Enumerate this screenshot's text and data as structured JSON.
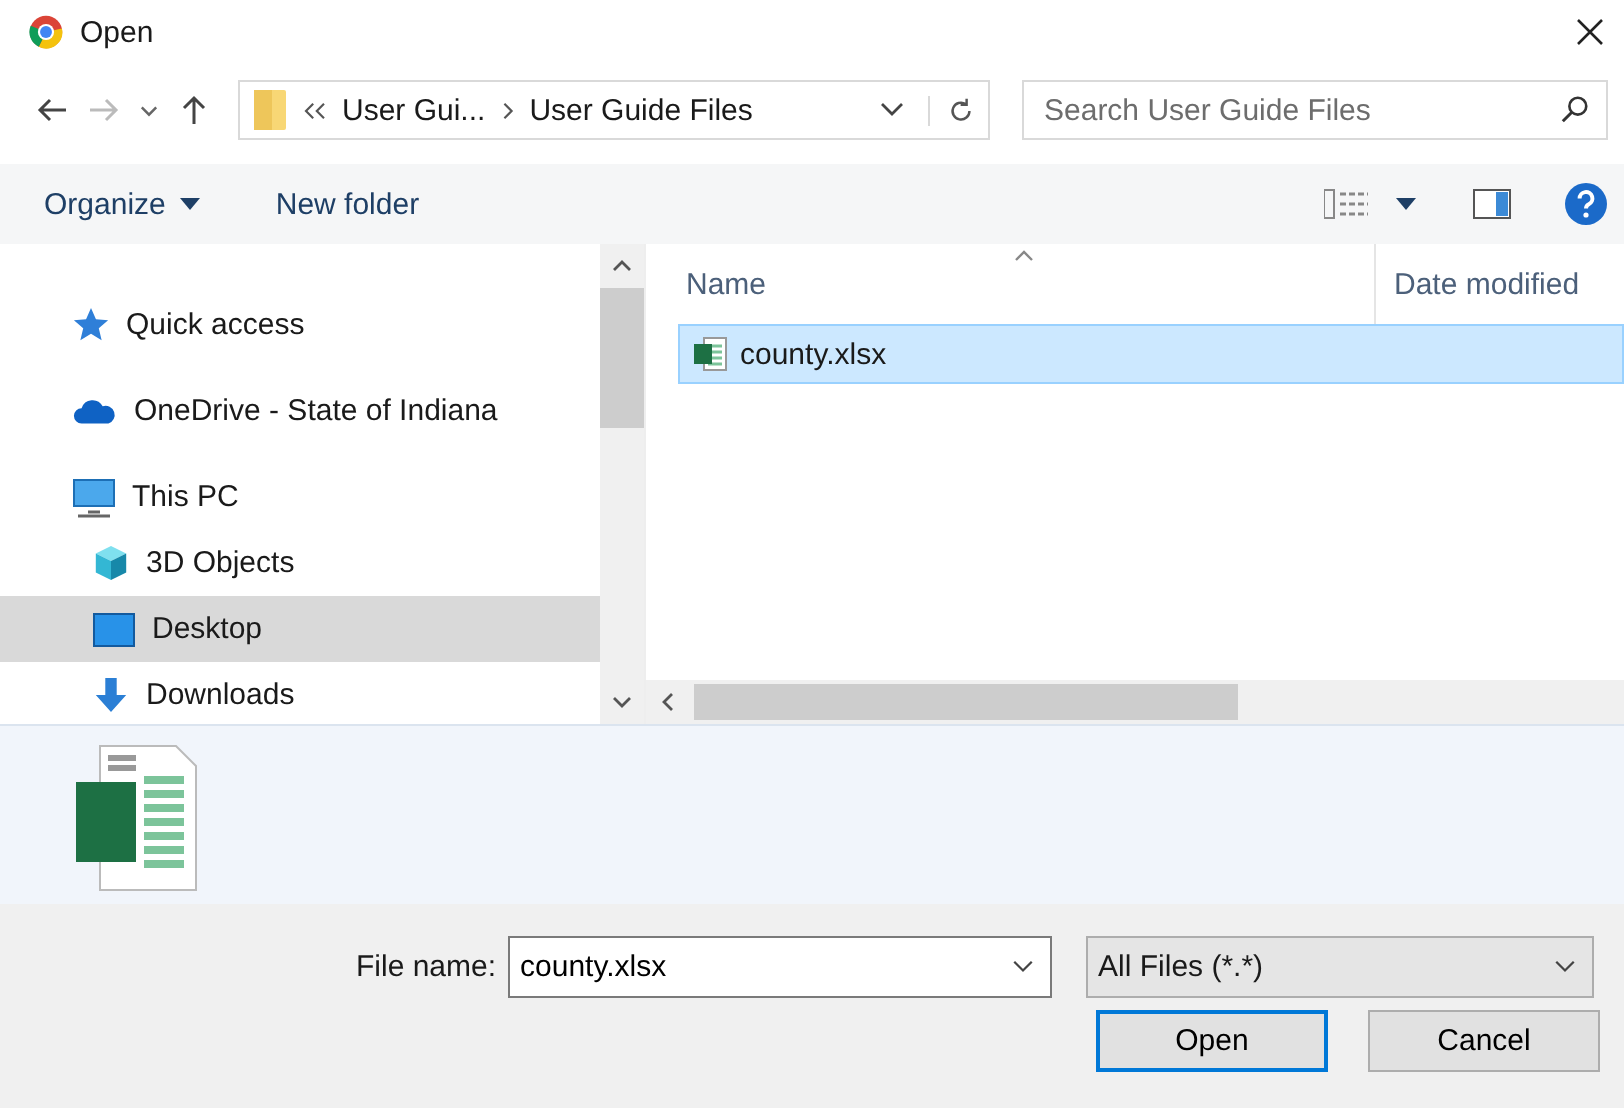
{
  "window": {
    "title": "Open"
  },
  "address": {
    "crumbs": [
      {
        "label": "User Gui..."
      },
      {
        "label": "User Guide Files"
      }
    ]
  },
  "search": {
    "placeholder": "Search User Guide Files"
  },
  "toolbar": {
    "buttons": [
      {
        "label": "Organize",
        "dropdown": true
      },
      {
        "label": "New folder",
        "dropdown": false
      }
    ]
  },
  "sidebar": {
    "items": [
      {
        "label": "Quick access",
        "selected": false
      },
      {
        "label": "OneDrive - State of Indiana",
        "selected": false
      },
      {
        "label": "This PC",
        "selected": false,
        "children": [
          {
            "label": "3D Objects",
            "selected": false
          },
          {
            "label": "Desktop",
            "selected": true
          },
          {
            "label": "Downloads",
            "selected": false
          }
        ]
      }
    ]
  },
  "file_list": {
    "columns": [
      "Name",
      "Date modified"
    ],
    "rows": [
      {
        "name": "county.xlsx",
        "selected": true
      }
    ]
  },
  "footer": {
    "file_name_label": "File name:",
    "file_name": "county.xlsx",
    "filter": "All Files (*.*)",
    "buttons": [
      {
        "label": "Open",
        "default": true
      },
      {
        "label": "Cancel",
        "default": false
      }
    ]
  }
}
